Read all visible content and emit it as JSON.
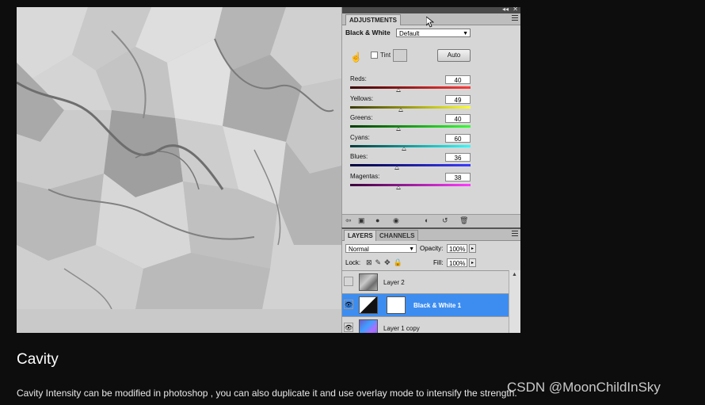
{
  "adjustments": {
    "tab_label": "ADJUSTMENTS",
    "title": "Black & White",
    "preset_value": "Default",
    "tint_label": "Tint",
    "auto_label": "Auto",
    "sliders": [
      {
        "label": "Reds:",
        "value": "40",
        "level": 0.4,
        "gradient": [
          "#3a0000",
          "#ff3b3b"
        ]
      },
      {
        "label": "Yellows:",
        "value": "49",
        "level": 0.42,
        "gradient": [
          "#3a3a00",
          "#ffff2e"
        ]
      },
      {
        "label": "Greens:",
        "value": "40",
        "level": 0.4,
        "gradient": [
          "#003a00",
          "#36ff36"
        ]
      },
      {
        "label": "Cyans:",
        "value": "60",
        "level": 0.45,
        "gradient": [
          "#003a3a",
          "#2effff"
        ]
      },
      {
        "label": "Blues:",
        "value": "36",
        "level": 0.39,
        "gradient": [
          "#00003a",
          "#3b3bff"
        ]
      },
      {
        "label": "Magentas:",
        "value": "38",
        "level": 0.4,
        "gradient": [
          "#3a003a",
          "#ff3bff"
        ]
      }
    ]
  },
  "layers": {
    "tab_label": "LAYERS",
    "channels_label": "CHANNELS",
    "blend_mode": "Normal",
    "opacity_label": "Opacity:",
    "opacity_value": "100%",
    "lock_label": "Lock:",
    "fill_label": "Fill:",
    "fill_value": "100%",
    "items": [
      {
        "name": "Layer 2",
        "visible": false,
        "selected": false
      },
      {
        "name": "Black & White 1",
        "visible": true,
        "selected": true
      },
      {
        "name": "Layer 1 copy",
        "visible": true,
        "selected": false
      }
    ]
  },
  "article": {
    "heading": "Cavity",
    "body": "Cavity Intensity can be modified in photoshop , you can also duplicate it and use overlay mode to intensify the strength.",
    "watermark": "CSDN @MoonChildInSky"
  }
}
